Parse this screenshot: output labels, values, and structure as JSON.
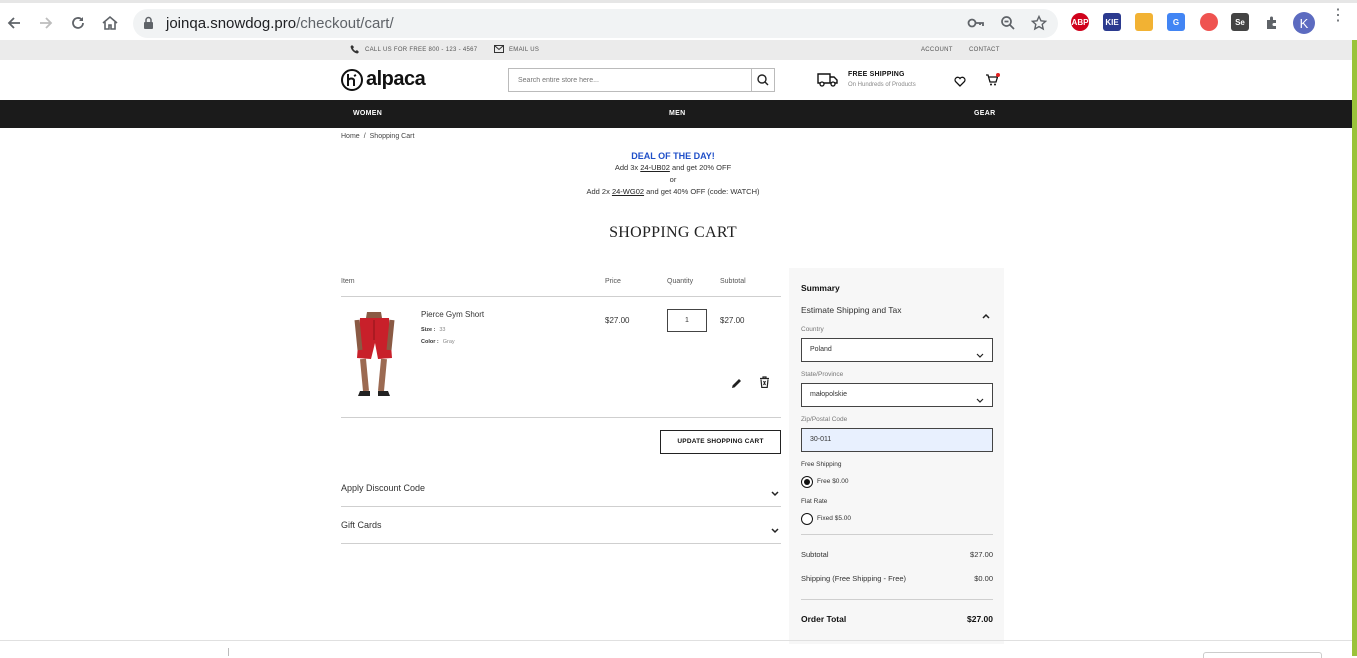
{
  "browser": {
    "url_host": "joinqa.snowdog.pro",
    "url_path": "/checkout/cart/",
    "profile_initial": "K",
    "extensions": [
      {
        "name": "adblock-plus-icon",
        "label": "ABP",
        "color": "#d0021b"
      },
      {
        "name": "extension-icon-2",
        "label": "KIE",
        "color": "#2b3a8f"
      },
      {
        "name": "extension-icon-3",
        "label": "",
        "color": "#f2b233"
      },
      {
        "name": "google-translate-icon",
        "label": "G",
        "color": "#4285f4"
      },
      {
        "name": "shield-extension-icon",
        "label": "",
        "color": "#ef5350"
      },
      {
        "name": "selenium-ide-icon",
        "label": "Se",
        "color": "#444444"
      }
    ]
  },
  "topbar": {
    "phone": "CALL US FOR FREE 800 - 123 - 4567",
    "email": "EMAIL US",
    "account": "ACCOUNT",
    "contact": "CONTACT"
  },
  "header": {
    "logo": "alpaca",
    "search_placeholder": "Search entire store here...",
    "shipping_title": "FREE SHIPPING",
    "shipping_sub": "On Hundreds of Products"
  },
  "nav": {
    "women": "WOMEN",
    "men": "MEN",
    "gear": "GEAR"
  },
  "breadcrumb": {
    "home": "Home",
    "sep": "/",
    "current": "Shopping Cart"
  },
  "deal": {
    "title": "DEAL OF THE DAY!",
    "line1_pre": "Add 3x ",
    "line1_sku": "24-UB02",
    "line1_post": " and get 20% OFF",
    "or": "or",
    "line2_pre": "Add 2x ",
    "line2_sku": "24-WG02",
    "line2_post": " and get 40% OFF (code: WATCH)"
  },
  "page_title": "SHOPPING CART",
  "cart": {
    "headers": {
      "item": "Item",
      "price": "Price",
      "quantity": "Quantity",
      "subtotal": "Subtotal"
    },
    "items": [
      {
        "name": "Pierce Gym Short",
        "size_label": "Size :",
        "size": "33",
        "color_label": "Color :",
        "color": "Gray",
        "price": "$27.00",
        "qty": "1",
        "subtotal": "$27.00"
      }
    ],
    "update_button": "UPDATE SHOPPING CART",
    "discount": "Apply Discount Code",
    "gift": "Gift Cards"
  },
  "summary": {
    "title": "Summary",
    "estimate": "Estimate Shipping and Tax",
    "country_label": "Country",
    "country": "Poland",
    "state_label": "State/Province",
    "state": "małopolskie",
    "zip_label": "Zip/Postal Code",
    "zip": "30-011",
    "free_shipping_title": "Free Shipping",
    "free_label": "Free",
    "free_price": "$0.00",
    "flat_rate_title": "Flat Rate",
    "fixed_label": "Fixed",
    "fixed_price": "$5.00",
    "subtotal_label": "Subtotal",
    "subtotal": "$27.00",
    "shipping_label": "Shipping (Free Shipping - Free)",
    "shipping": "$0.00",
    "total_label": "Order Total",
    "total": "$27.00"
  },
  "colors": {
    "nav_bg": "#1b1b1b",
    "deal_title": "#1f4fc8",
    "accent_green": "#9ac33a"
  }
}
